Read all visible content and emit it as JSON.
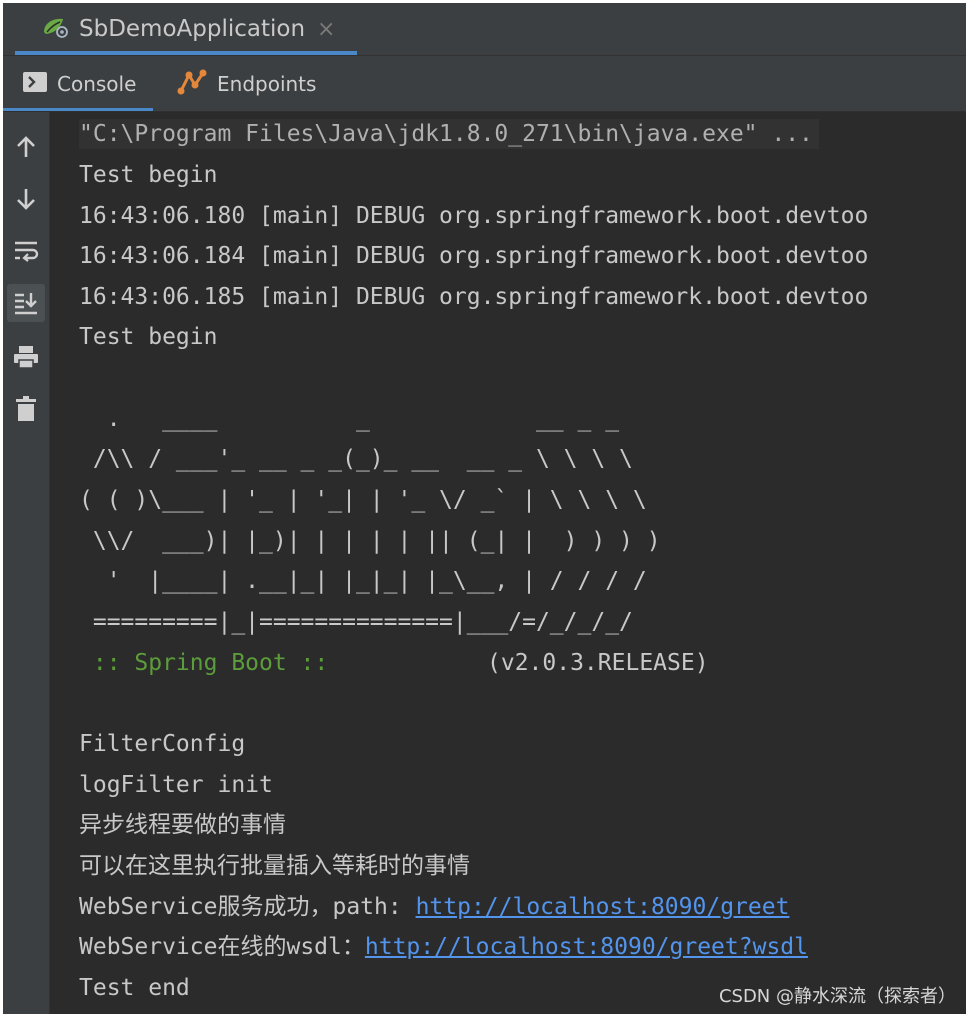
{
  "run_tab": {
    "title": "SbDemoApplication",
    "close_glyph": "×"
  },
  "tool_tabs": {
    "console": "Console",
    "endpoints": "Endpoints"
  },
  "gutter_icons": [
    "up-arrow-icon",
    "down-arrow-icon",
    "soft-wrap-icon",
    "scroll-to-end-icon",
    "print-icon",
    "trash-icon"
  ],
  "console_lines": {
    "cmd": "\"C:\\Program Files\\Java\\jdk1.8.0_271\\bin\\java.exe\" ...",
    "l1": "Test begin",
    "l2": "16:43:06.180 [main] DEBUG org.springframework.boot.devtoo",
    "l3": "16:43:06.184 [main] DEBUG org.springframework.boot.devtoo",
    "l4": "16:43:06.185 [main] DEBUG org.springframework.boot.devtoo",
    "l5": "Test begin",
    "banner1": "  .   ____          _            __ _ _",
    "banner2": " /\\\\ / ___'_ __ _ _(_)_ __  __ _ \\ \\ \\ \\",
    "banner3": "( ( )\\___ | '_ | '_| | '_ \\/ _` | \\ \\ \\ \\",
    "banner4": " \\\\/  ___)| |_)| | | | | || (_| |  ) ) ) )",
    "banner5": "  '  |____| .__|_| |_|_| |_\\__, | / / / /",
    "banner6": " =========|_|==============|___/=/_/_/_/",
    "spring_label": " :: Spring Boot ::",
    "spring_version": "(v2.0.3.RELEASE)",
    "l6": "FilterConfig",
    "l7": "logFilter init",
    "l8": "异步线程要做的事情",
    "l9": "可以在这里执行批量插入等耗时的事情",
    "l10_prefix": "WebService服务成功，path: ",
    "l10_link": "http://localhost:8090/greet",
    "l11_prefix": "WebService在线的wsdl：",
    "l11_link": "http://localhost:8090/greet?wsdl",
    "l12": "Test end"
  },
  "watermark": "CSDN @静水深流（探索者）",
  "colors": {
    "link": "#5394ec",
    "spring_green": "#5c9d3b",
    "accent": "#4a88c7"
  }
}
